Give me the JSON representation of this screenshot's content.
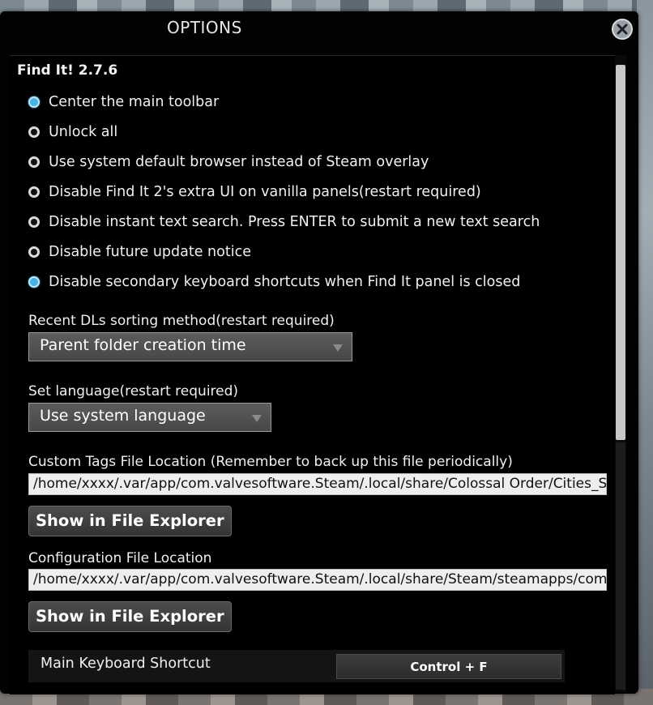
{
  "window": {
    "title": "OPTIONS"
  },
  "panel": {
    "section_title": "Find It! 2.7.6",
    "options": [
      {
        "label": "Center the main toolbar",
        "checked": true
      },
      {
        "label": "Unlock all",
        "checked": false
      },
      {
        "label": "Use system default browser instead of Steam overlay",
        "checked": false
      },
      {
        "label": "Disable Find It 2's extra UI on vanilla panels(restart required)",
        "checked": false
      },
      {
        "label": "Disable instant text search. Press ENTER to submit a new text search",
        "checked": false
      },
      {
        "label": "Disable future update notice",
        "checked": false
      },
      {
        "label": "Disable secondary keyboard shortcuts when Find It panel is closed",
        "checked": true
      }
    ],
    "recent_dls": {
      "label": "Recent DLs sorting method(restart required)",
      "value": "Parent folder creation time"
    },
    "language": {
      "label": "Set language(restart required)",
      "value": "Use system language"
    },
    "custom_tags": {
      "label": "Custom Tags File Location (Remember to back up this file periodically)",
      "path": "/home/xxxx/.var/app/com.valvesoftware.Steam/.local/share/Colossal Order/Cities_Skylines",
      "button": "Show in File Explorer"
    },
    "config_file": {
      "label": "Configuration File Location",
      "path": "/home/xxxx/.var/app/com.valvesoftware.Steam/.local/share/Steam/steamapps/common",
      "button": "Show in File Explorer"
    },
    "shortcut": {
      "label": "Main Keyboard Shortcut",
      "key": "Control + F"
    }
  },
  "colors": {
    "radio_on": "#45b4e6",
    "background": "#000000"
  }
}
